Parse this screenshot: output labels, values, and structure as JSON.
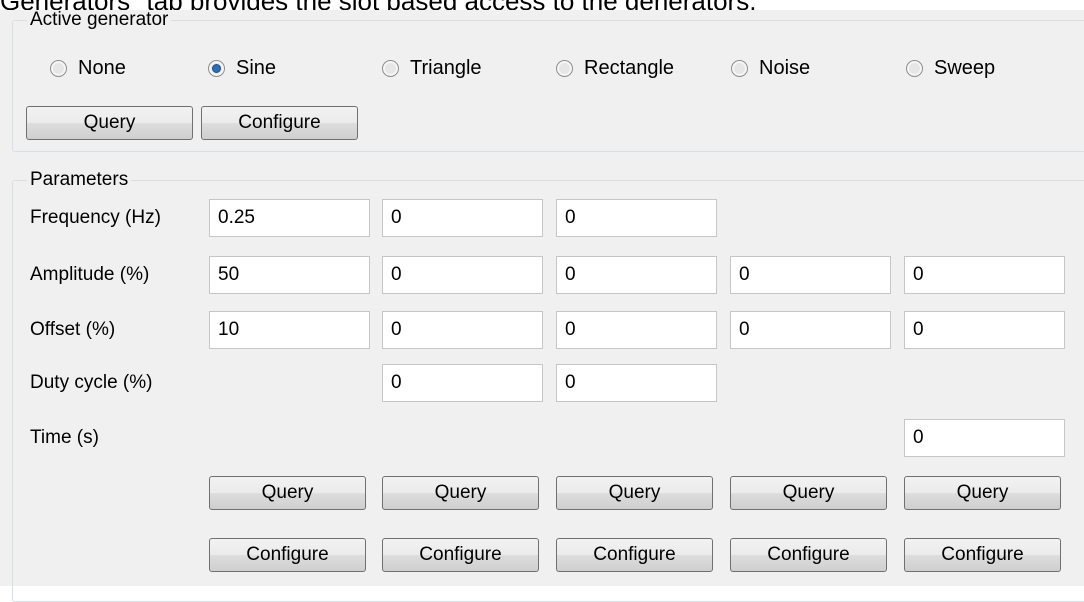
{
  "doc_text": "Generators\" tab provides the slot based access to the generators.",
  "active_generator": {
    "legend": "Active generator",
    "options": [
      {
        "label": "None",
        "checked": false
      },
      {
        "label": "Sine",
        "checked": true
      },
      {
        "label": "Triangle",
        "checked": false
      },
      {
        "label": "Rectangle",
        "checked": false
      },
      {
        "label": "Noise",
        "checked": false
      },
      {
        "label": "Sweep",
        "checked": false
      }
    ],
    "query_label": "Query",
    "configure_label": "Configure"
  },
  "parameters": {
    "legend": "Parameters",
    "rows": [
      {
        "label": "Frequency (Hz)",
        "values": [
          "0.25",
          "0",
          "0",
          null,
          null
        ]
      },
      {
        "label": "Amplitude (%)",
        "values": [
          "50",
          "0",
          "0",
          "0",
          "0"
        ]
      },
      {
        "label": "Offset (%)",
        "values": [
          "10",
          "0",
          "0",
          "0",
          "0"
        ]
      },
      {
        "label": "Duty cycle (%)",
        "values": [
          null,
          "0",
          "0",
          null,
          null
        ]
      },
      {
        "label": "Time (s)",
        "values": [
          null,
          null,
          null,
          null,
          "0"
        ]
      }
    ],
    "query_label": "Query",
    "configure_label": "Configure"
  }
}
